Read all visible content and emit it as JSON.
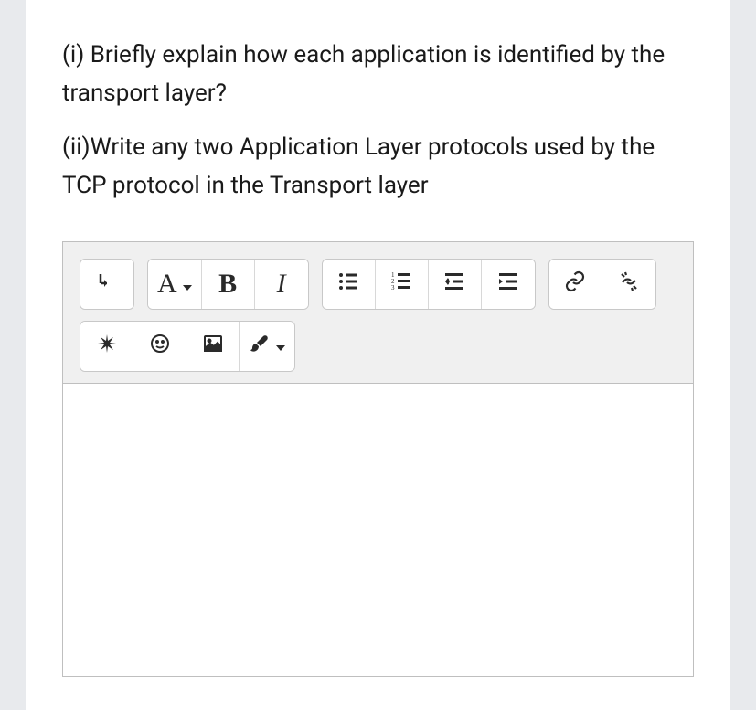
{
  "question": {
    "part1": "(i) Briefly explain how each application is identified by the transport layer?",
    "part2": "(ii)Write any two Application Layer protocols used by the TCP protocol in the Transport layer"
  },
  "toolbar": {
    "expand_label": "↴",
    "font_family_label": "A",
    "bold_label": "B",
    "italic_label": "I"
  }
}
